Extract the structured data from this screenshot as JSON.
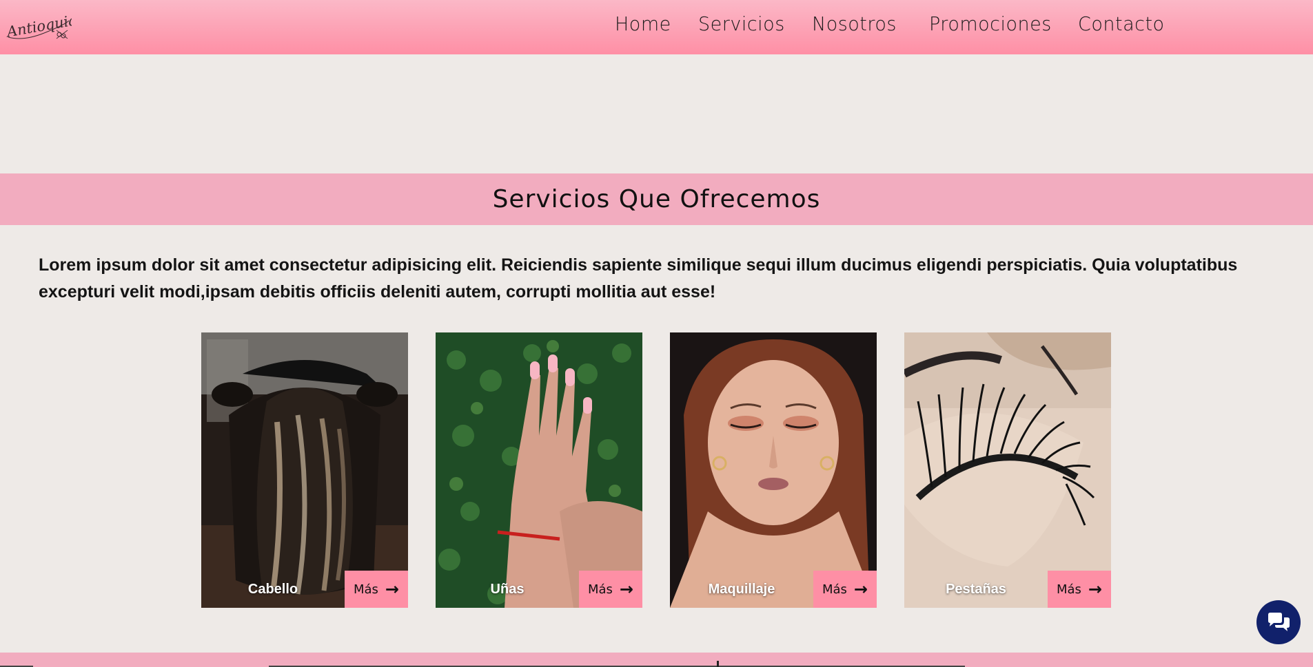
{
  "brand": {
    "logo_text": "Antioquia"
  },
  "nav": {
    "items": [
      "Home",
      "Servicios",
      "Nosotros",
      "Promociones",
      "Contacto"
    ]
  },
  "services": {
    "title": "Servicios Que Ofrecemos",
    "intro": "Lorem ipsum dolor sit amet consectetur adipisicing elit. Reiciendis sapiente similique sequi illum ducimus eligendi perspiciatis. Quia voluptatibus excepturi velit modi,ipsam debitis officiis deleniti autem, corrupti mollitia aut esse!",
    "cards": [
      {
        "label": "Cabello",
        "button": "Más"
      },
      {
        "label": "Uñas",
        "button": "Más"
      },
      {
        "label": "Maquillaje",
        "button": "Más"
      },
      {
        "label": "Pestañas",
        "button": "Más"
      }
    ]
  },
  "colors": {
    "header": "#fe8fa5",
    "band": "#f2acbf",
    "background": "#eeeae7",
    "chat": "#11216b"
  },
  "icons": {
    "more": "arrow-right-icon",
    "chat": "chat-bubbles-icon"
  }
}
